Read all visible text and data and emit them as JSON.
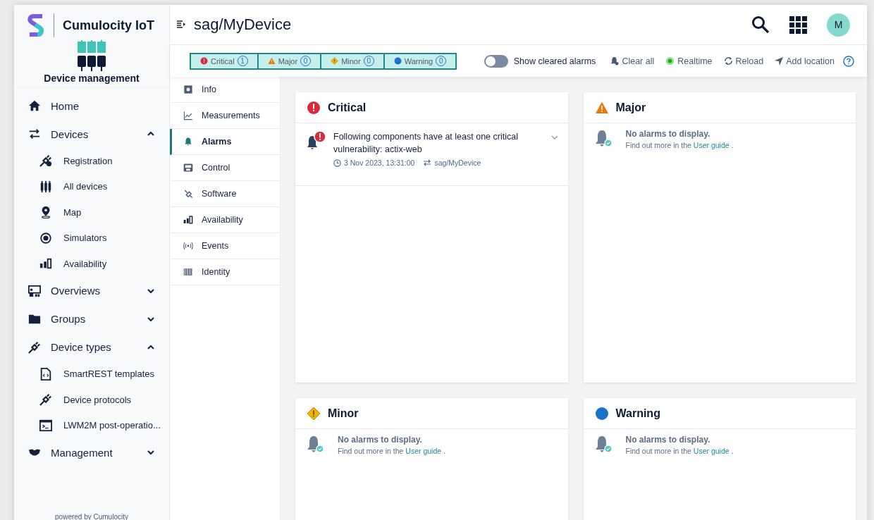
{
  "app": {
    "name": "Cumulocity IoT",
    "section": "Device management",
    "footer": "powered by Cumulocity"
  },
  "nav": [
    {
      "label": "Home"
    },
    {
      "label": "Devices",
      "expanded": true,
      "children": [
        {
          "label": "Registration"
        },
        {
          "label": "All devices"
        },
        {
          "label": "Map"
        },
        {
          "label": "Simulators"
        },
        {
          "label": "Availability"
        }
      ]
    },
    {
      "label": "Overviews",
      "expanded": false
    },
    {
      "label": "Groups",
      "expanded": false
    },
    {
      "label": "Device types",
      "expanded": true,
      "children": [
        {
          "label": "SmartREST templates"
        },
        {
          "label": "Device protocols"
        },
        {
          "label": "LWM2M post-operatio..."
        }
      ]
    },
    {
      "label": "Management",
      "expanded": false
    }
  ],
  "header": {
    "title": "sag/MyDevice",
    "avatar": "M"
  },
  "filters": [
    {
      "kind": "critical",
      "label": "Critical",
      "count": "1",
      "selected": true
    },
    {
      "kind": "major",
      "label": "Major",
      "count": "0",
      "selected": true
    },
    {
      "kind": "minor",
      "label": "Minor",
      "count": "0",
      "selected": true
    },
    {
      "kind": "warning",
      "label": "Warning",
      "count": "0",
      "selected": true
    }
  ],
  "toolbar": {
    "toggle": {
      "label": "Show cleared alarms",
      "on": false
    },
    "actions": [
      {
        "kind": "clear",
        "label": "Clear all"
      },
      {
        "kind": "realtime",
        "label": "Realtime",
        "on": true
      },
      {
        "kind": "reload",
        "label": "Reload"
      },
      {
        "kind": "location",
        "label": "Add location"
      },
      {
        "kind": "help"
      }
    ]
  },
  "tabs": [
    {
      "label": "Info",
      "selected": false
    },
    {
      "label": "Measurements",
      "selected": false
    },
    {
      "label": "Alarms",
      "selected": true
    },
    {
      "label": "Control",
      "selected": false
    },
    {
      "label": "Software",
      "selected": false
    },
    {
      "label": "Availability",
      "selected": false
    },
    {
      "label": "Events",
      "selected": false
    },
    {
      "label": "Identity",
      "selected": false
    }
  ],
  "panels": [
    {
      "kind": "critical",
      "title": "Critical",
      "alarms": [
        {
          "text": "Following components have at least one critical vulnerability: actix-web",
          "time": "3 Nov 2023, 13:31:00",
          "source": "sag/MyDevice"
        }
      ]
    },
    {
      "kind": "major",
      "title": "Major",
      "empty": {
        "message": "No alarms to display.",
        "hint": "Find out more in the",
        "link": "User guide",
        "after": "."
      }
    },
    {
      "kind": "minor",
      "title": "Minor",
      "empty": {
        "message": "No alarms to display.",
        "hint": "Find out more in the",
        "link": "User guide",
        "after": "."
      }
    },
    {
      "kind": "warning",
      "title": "Warning",
      "empty": {
        "message": "No alarms to display.",
        "hint": "Find out more in the",
        "link": "User guide",
        "after": "."
      }
    }
  ]
}
